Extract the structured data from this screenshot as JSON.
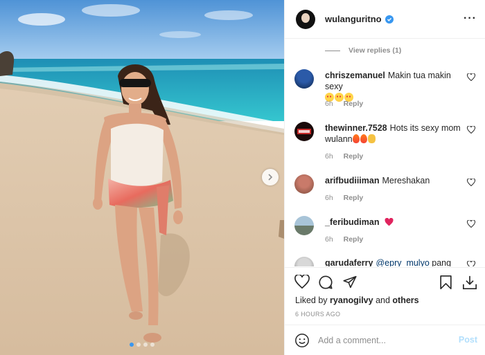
{
  "post": {
    "username": "wulanguritno",
    "verified": true,
    "more_icon": "more-options-icon",
    "carousel": {
      "slides": 4,
      "active_index": 0
    }
  },
  "comments_section": {
    "view_replies_label": "View replies (1)",
    "items": [
      {
        "username": "chriszemanuel",
        "text": "Makin tua makin sexy",
        "emojis": [
          "love",
          "love",
          "love"
        ],
        "time": "6h",
        "reply_label": "Reply"
      },
      {
        "username": "thewinner.7528",
        "text": "Hots its sexy mom wulann",
        "emojis": [
          "fire",
          "fire",
          "clap"
        ],
        "time": "6h",
        "reply_label": "Reply"
      },
      {
        "username": "arifbudiiiman",
        "text": "Mereshakan",
        "emojis": [],
        "time": "6h",
        "reply_label": "Reply"
      },
      {
        "username": "_feribudiman",
        "text": "",
        "emojis": [
          "red-heart"
        ],
        "time": "6h",
        "reply_label": "Reply"
      },
      {
        "username": "garudaferry",
        "mention": "@epry_mulyo",
        "text": "pang",
        "emojis": [],
        "time": "",
        "reply_label": ""
      }
    ]
  },
  "actions": {
    "liked_by_prefix": "Liked by",
    "liked_by_user": "ryanogilvy",
    "liked_by_and": "and",
    "liked_by_others": "others",
    "timestamp": "6 HOURS AGO"
  },
  "composer": {
    "placeholder": "Add a comment...",
    "post_label": "Post"
  },
  "colors": {
    "accent": "#3897f0",
    "post_disabled": "#b2dffc",
    "meta_gray": "#8e8e8e",
    "heart_red": "#ed4956"
  }
}
